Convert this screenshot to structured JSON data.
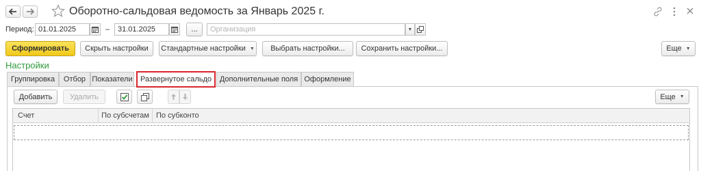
{
  "header": {
    "title": "Оборотно-сальдовая ведомость за Январь 2025 г.",
    "link_icon": "link-icon",
    "more_icon": "more-vert-icon",
    "close_icon": "close-icon"
  },
  "period": {
    "label": "Период:",
    "from": "01.01.2025",
    "separator": "–",
    "to": "31.01.2025",
    "select_button": "...",
    "organization_placeholder": "Организация"
  },
  "toolbar": {
    "generate": "Сформировать",
    "hide_settings": "Скрыть настройки",
    "standard_settings": "Стандартные настройки",
    "choose_settings": "Выбрать настройки...",
    "save_settings": "Сохранить настройки...",
    "more": "Еще"
  },
  "settings": {
    "heading": "Настройки",
    "tabs": [
      {
        "label": "Группировка"
      },
      {
        "label": "Отбор"
      },
      {
        "label": "Показатели"
      },
      {
        "label": "Развернутое сальдо"
      },
      {
        "label": "Дополнительные поля"
      },
      {
        "label": "Оформление"
      }
    ],
    "active_tab": "Развернутое сальдо"
  },
  "subtoolbar": {
    "add": "Добавить",
    "delete": "Удалить",
    "more": "Еще"
  },
  "table": {
    "columns": [
      {
        "label": "Счет"
      },
      {
        "label": "По субсчетам"
      },
      {
        "label": "По субконто"
      }
    ]
  },
  "colors": {
    "accent_yellow": "#f5d22c",
    "settings_green": "#2f9a3b",
    "highlight_red": "#d9262b"
  }
}
